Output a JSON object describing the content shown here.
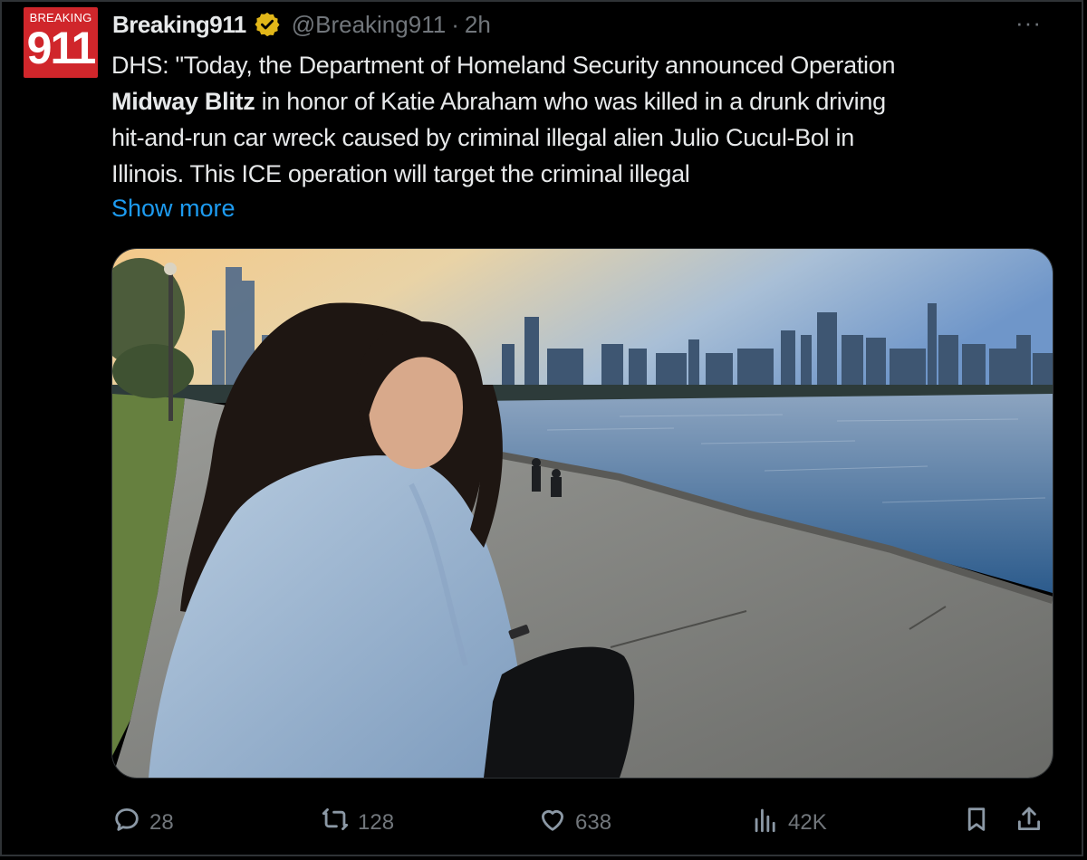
{
  "avatar": {
    "top_text": "BREAKING",
    "number": "911"
  },
  "header": {
    "display_name": "Breaking911",
    "handle": "@Breaking911",
    "separator": "·",
    "time": "2h",
    "more": "···"
  },
  "tweet": {
    "line1": "DHS: \"Today, the Department of Homeland Security announced Operation",
    "bold": "Midway Blitz",
    "line2_rest": " in honor of Katie Abraham who was killed in a drunk driving",
    "line3": "hit-and-run car wreck caused by criminal illegal alien Julio Cucul-Bol in",
    "line4": "Illinois. This ICE operation will target the criminal illegal",
    "show_more": "Show more"
  },
  "actions": {
    "replies": "28",
    "reposts": "128",
    "likes": "638",
    "views": "42K"
  },
  "icons": {
    "verified": "verified-badge-icon",
    "reply": "reply-icon",
    "repost": "repost-icon",
    "like": "heart-icon",
    "views": "views-icon",
    "bookmark": "bookmark-icon",
    "share": "share-icon"
  },
  "colors": {
    "background": "#000000",
    "text": "#e7e9ea",
    "muted": "#71767b",
    "link": "#1d9bf0",
    "verified": "#e2b719",
    "avatar": "#d0262b"
  }
}
